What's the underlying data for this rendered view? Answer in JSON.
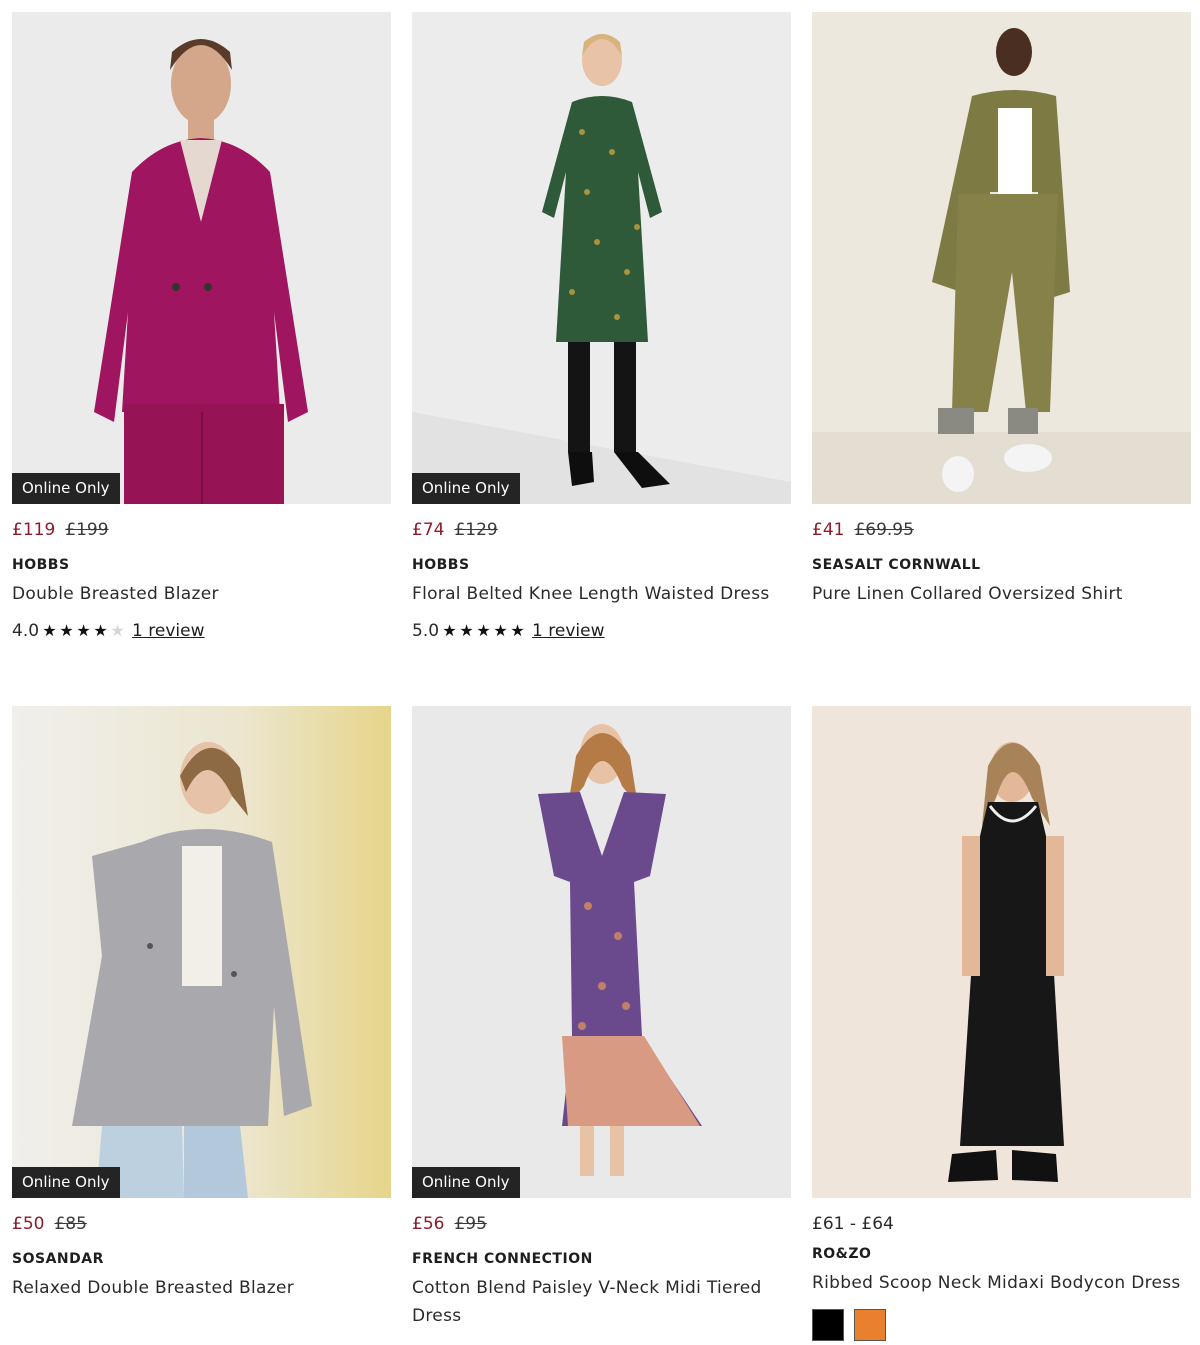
{
  "products": [
    {
      "badge": "Online Only",
      "price_now": "£119",
      "price_was": "£199",
      "brand": "HOBBS",
      "name": "Double Breasted Blazer",
      "rating": "4.0",
      "stars_filled": 4,
      "review_link": "1 review",
      "image": {
        "description_icon": "model-magenta-blazer-photo",
        "bg": "#ebebec",
        "garment": "#a0155f"
      }
    },
    {
      "badge": "Online Only",
      "price_now": "£74",
      "price_was": "£129",
      "brand": "HOBBS",
      "name": "Floral Belted Knee Length Waisted Dress",
      "rating": "5.0",
      "stars_filled": 5,
      "review_link": "1 review",
      "image": {
        "description_icon": "model-green-floral-dress-photo",
        "bg": "#ececec",
        "garment": "#2e5a3a"
      }
    },
    {
      "price_now": "£41",
      "price_was": "£69.95",
      "brand": "SEASALT CORNWALL",
      "name": "Pure Linen Collared Oversized Shirt",
      "image": {
        "description_icon": "model-olive-linen-shirt-photo",
        "bg": "#ede8de",
        "garment": "#7d7a43"
      }
    },
    {
      "badge": "Online Only",
      "price_now": "£50",
      "price_was": "£85",
      "brand": "SOSANDAR",
      "name": "Relaxed Double Breasted Blazer",
      "image": {
        "description_icon": "model-grey-blazer-photo",
        "bg": "#eae6d8",
        "garment": "#a9a9ad"
      }
    },
    {
      "badge": "Online Only",
      "price_now": "£56",
      "price_was": "£95",
      "brand": "FRENCH CONNECTION",
      "name": "Cotton Blend Paisley V-Neck Midi Tiered Dress",
      "image": {
        "description_icon": "model-paisley-midi-dress-photo",
        "bg": "#e9e9ea",
        "garment": "#6a4a8c"
      }
    },
    {
      "price_range": "£61 - £64",
      "brand": "RO&ZO",
      "name": "Ribbed Scoop Neck Midaxi Bodycon Dress",
      "swatches": [
        "#000000",
        "#e8802e"
      ],
      "image": {
        "description_icon": "model-black-ribbed-dress-photo",
        "bg": "#efe5db",
        "garment": "#171717"
      }
    }
  ],
  "colors": {
    "sale_price": "#8c1b2b",
    "badge_bg": "#242424"
  }
}
